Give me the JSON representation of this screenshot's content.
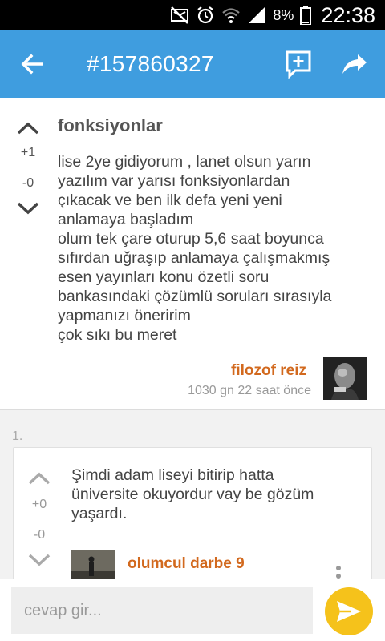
{
  "status_bar": {
    "battery_percent": "8%",
    "time": "22:38",
    "icons": [
      "mute-icon",
      "alarm-icon",
      "wifi-icon",
      "signal-icon",
      "battery-icon"
    ]
  },
  "app_bar": {
    "title": "#157860327",
    "color": "#3f9ddf",
    "icons": [
      "back-arrow-icon",
      "add-comment-icon",
      "share-icon"
    ]
  },
  "post": {
    "title": "fonksiyonlar",
    "upvotes": "+1",
    "downvotes": "-0",
    "body_lines": [
      "lise 2ye gidiyorum , lanet olsun yarın",
      "yazılım var yarısı fonksiyonlardan",
      "çıkacak ve ben ilk defa yeni yeni",
      "anlamaya başladım",
      "olum tek çare oturup 5,6 saat boyunca",
      "sıfırdan uğraşıp anlamaya çalışmakmış",
      "esen yayınları konu özetli soru",
      "bankasındaki çözümlü soruları sırasıyla",
      "yapmanızı öneririm",
      "çok sıkı bu meret"
    ],
    "author": "filozof reiz",
    "time_ago": "1030 gn 22 saat  önce",
    "author_color": "#d2691e"
  },
  "replies": {
    "number_label": "1.",
    "items": [
      {
        "upvotes": "+0",
        "downvotes": "-0",
        "body_lines": [
          "Şimdi adam liseyi bitirip hatta",
          "üniversite okuyordur vay be gözüm",
          "yaşardı."
        ],
        "author": "olumcul darbe 9"
      }
    ]
  },
  "composer": {
    "placeholder": "cevap gir...",
    "send_color": "#f5c21b"
  }
}
